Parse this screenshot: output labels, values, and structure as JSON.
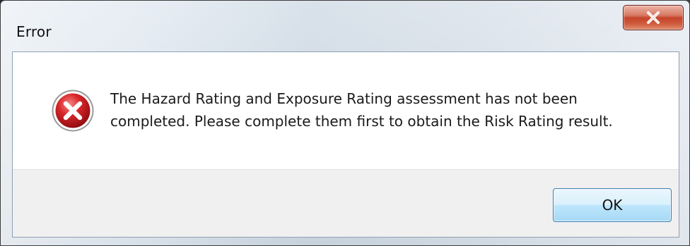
{
  "window": {
    "title": "Error"
  },
  "dialog": {
    "icon": "error-icon",
    "message_line1": "The Hazard Rating and Exposure Rating assessment has not been",
    "message_line2": "completed. Please complete them first to obtain the Risk Rating result.",
    "ok_label": "OK"
  },
  "colors": {
    "close_button_red": "#c4442a",
    "error_icon_red": "#c7141b",
    "ok_button_border": "#3c7fb1",
    "footer_bg": "#f0f0f0"
  }
}
